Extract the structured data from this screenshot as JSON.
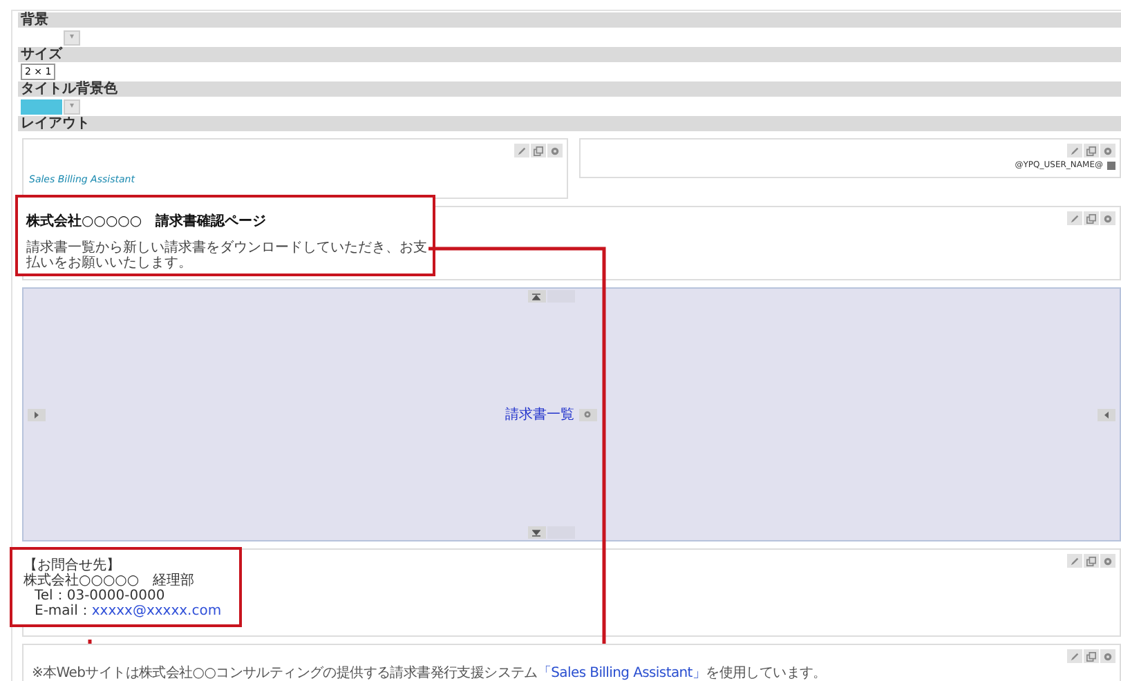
{
  "settings": [
    {
      "label": "背景",
      "kind": "color_picker",
      "button": "▾"
    },
    {
      "label": "サイズ",
      "kind": "select",
      "value": "2 × 1"
    },
    {
      "label": "タイトル背景色",
      "kind": "color_picker",
      "color": "#4fc3df",
      "button": "▾"
    },
    {
      "label": "レイアウト",
      "kind": "heading"
    }
  ],
  "header": {
    "logo": "Sales Billing Assistant",
    "user": "@YPQ_USER_NAME@"
  },
  "title_block": {
    "title": "株式会社○○○○○　請求書確認ページ",
    "subtitle": "請求書一覧から新しい請求書をダウンロードしていただき、お支払いをお願いいたします。"
  },
  "main_area": {
    "link": "請求書一覧"
  },
  "contact": {
    "heading": "【お問合せ先】",
    "company": "株式会社○○○○○　経理部",
    "tel": "Tel：03-0000-0000",
    "email_label": "E-mail：",
    "email": "xxxxx@xxxxx.com"
  },
  "footer": {
    "before": "※本Webサイトは株式会社○○コンサルティングの提供する請求書発行支援システム",
    "link": "「Sales Billing Assistant」",
    "after": "を使用しています。"
  }
}
